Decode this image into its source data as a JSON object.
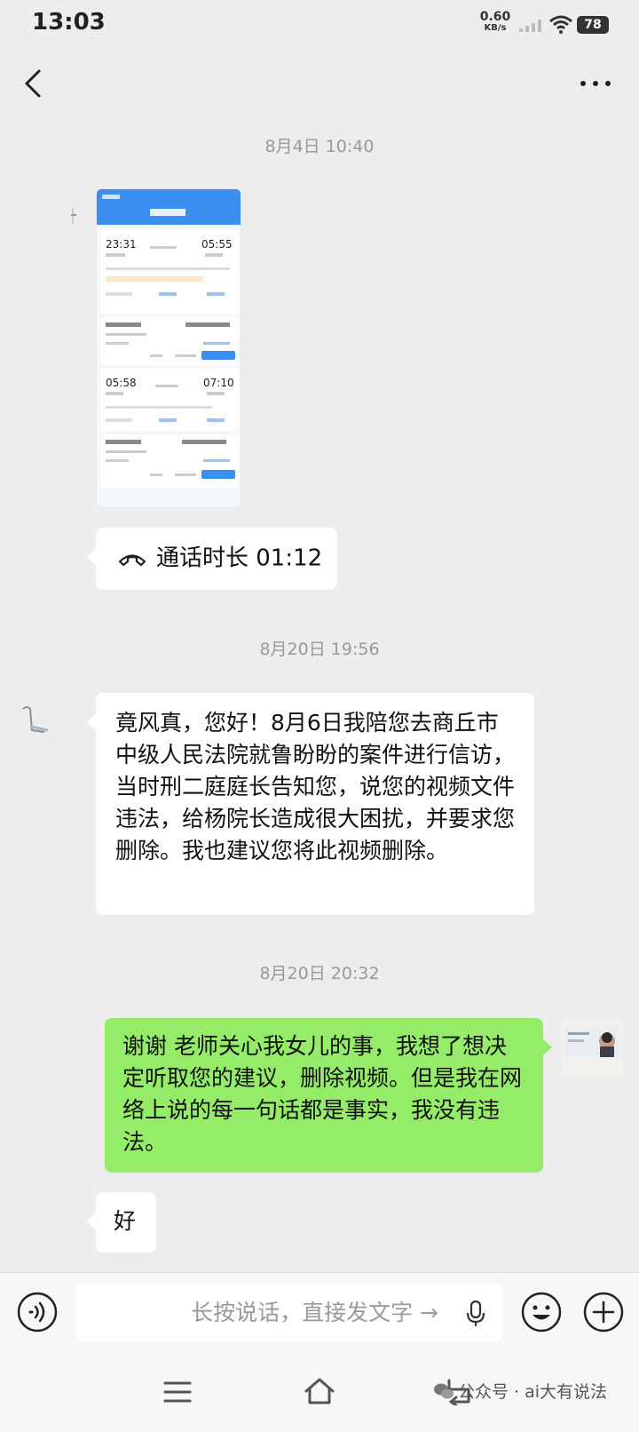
{
  "status_bar": {
    "time": "13:03",
    "net_speed_value": "0.60",
    "net_speed_unit": "KB/s",
    "battery": "78",
    "icons": [
      "signal-icon",
      "wifi-icon",
      "battery-icon"
    ]
  },
  "nav": {
    "icons": [
      "back-icon",
      "more-icon"
    ]
  },
  "messages": {
    "ts1": "8月4日 10:40",
    "image": {
      "kind": "train-ticket-order-screenshot",
      "trip1_depart": "23:31",
      "trip1_arrive": "05:55",
      "trip2_depart": "05:58",
      "trip2_arrive": "07:10"
    },
    "call": {
      "text": "通话时长 01:12",
      "icon": "phone-hangup-icon"
    },
    "ts2": "8月20日 19:56",
    "msg1": "竟风真，您好！8月6日我陪您去商丘市中级人民法院就鲁盼盼的案件进行信访，当时刑二庭庭长告知您，说您的视频文件违法，给杨院长造成很大困扰，并要求您删除。我也建议您将此视频删除。",
    "ts3": "8月20日 20:32",
    "msg2": "谢谢  老师关心我女儿的事，我想了想决定听取您的建议，删除视频。但是我在网络上说的每一句话都是事实，我没有违法。",
    "msg3": "好"
  },
  "input_bar": {
    "placeholder": "长按说话，直接发文字 →",
    "icons": [
      "voice-icon",
      "mic-icon",
      "emoji-icon",
      "plus-icon"
    ]
  },
  "system_nav": {
    "icons": [
      "menu-icon",
      "home-icon",
      "back-icon"
    ],
    "watermark": "公众号 · ai大有说法"
  },
  "colors": {
    "background": "#ededed",
    "bubble_self": "#95ec69",
    "bubble_other": "#ffffff",
    "timestamp": "#999999"
  }
}
